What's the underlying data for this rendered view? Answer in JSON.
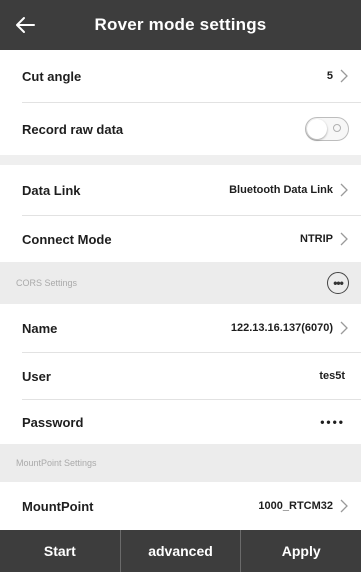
{
  "header": {
    "back_icon": "arrow-left-icon",
    "title": "Rover mode settings"
  },
  "rows": {
    "cut_angle": {
      "label": "Cut angle",
      "value": "5"
    },
    "record_raw": {
      "label": "Record raw data",
      "enabled": false
    },
    "data_link": {
      "label": "Data Link",
      "value": "Bluetooth Data Link"
    },
    "connect_mode": {
      "label": "Connect Mode",
      "value": "NTRIP"
    }
  },
  "cors": {
    "section_label": "CORS Settings",
    "more_icon": "more-icon",
    "more_glyph": "•••",
    "name": {
      "label": "Name",
      "value": "122.13.16.137(6070)"
    },
    "user": {
      "label": "User",
      "value": "tes5t"
    },
    "password": {
      "label": "Password",
      "value": "••••"
    }
  },
  "mountpoint": {
    "section_label": "MountPoint Settings",
    "row": {
      "label": "MountPoint",
      "value": "1000_RTCM32"
    }
  },
  "footer": {
    "start": "Start",
    "advanced": "advanced",
    "apply": "Apply"
  },
  "colors": {
    "bar": "#3d3d3d",
    "section_bg": "#ececec",
    "text": "#1e1e1e"
  }
}
